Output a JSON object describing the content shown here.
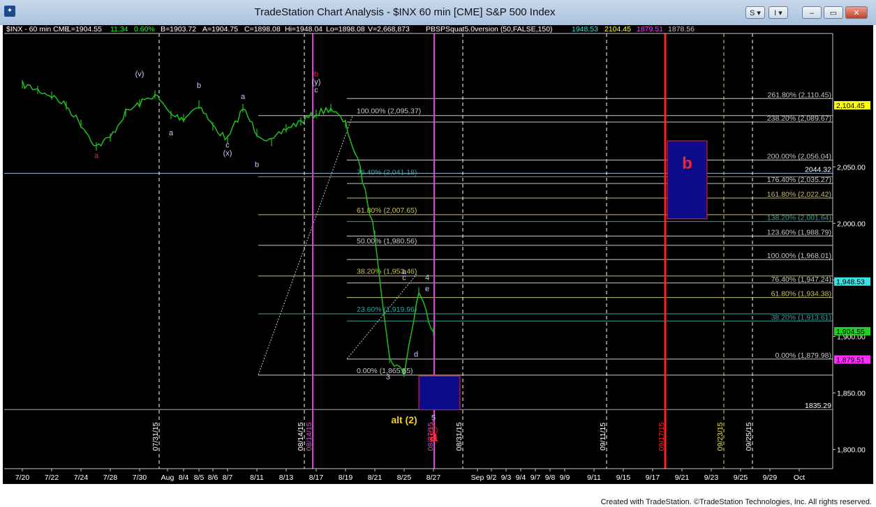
{
  "window": {
    "title": "TradeStation Chart Analysis - $INX 60 min [CME] S&P 500 Index",
    "btn_s": "S",
    "btn_i": "I",
    "footer": "Created with TradeStation. ©TradeStation Technologies, Inc. All rights reserved."
  },
  "header": {
    "symbol": "$INX - 60 min  CME",
    "last": "L=1904.55",
    "chg": "11.34",
    "pct": "0.60%",
    "bid": "B=1903.72",
    "ask": "A=1904.75",
    "close": "C=1898.08",
    "hi": "Hi=1948.04",
    "lo": "Lo=1898.08",
    "vol": "V=2,668,873",
    "indicator": "PBSPSquat5.0version (50,FALSE,150)",
    "ind_values": [
      "1948.53",
      "2104.45",
      "1879.51",
      "1878.56"
    ]
  },
  "chart_data": {
    "type": "line",
    "title": "$INX 60 min [CME] S&P 500 Index",
    "xlabel": "",
    "ylabel": "",
    "grid": false,
    "legend": "none",
    "x_ticks": [
      "7/20",
      "7/22",
      "7/24",
      "7/28",
      "7/30",
      "Aug",
      "8/4",
      "8/5",
      "8/6",
      "8/7",
      "8/11",
      "8/13",
      "8/17",
      "8/19",
      "8/21",
      "8/25",
      "8/27",
      "Sep",
      "9/2",
      "9/3",
      "9/4",
      "9/7",
      "9/8",
      "9/9",
      "9/11",
      "9/15",
      "9/17",
      "9/21",
      "9/23",
      "9/25",
      "9/29",
      "Oct"
    ],
    "y_ticks": [
      "2,050.00",
      "2,000.00",
      "1,950.00",
      "1,900.00",
      "1,850.00",
      "1,800.00"
    ],
    "ylim": [
      1783,
      2168
    ],
    "price_series": [
      {
        "t": "7/20",
        "p": 2123
      },
      {
        "t": "7/21",
        "p": 2118
      },
      {
        "t": "7/22",
        "p": 2113
      },
      {
        "t": "7/23",
        "p": 2104
      },
      {
        "t": "7/24",
        "p": 2088
      },
      {
        "t": "7/27",
        "p": 2068
      },
      {
        "t": "7/28",
        "p": 2076
      },
      {
        "t": "7/29",
        "p": 2098
      },
      {
        "t": "7/30",
        "p": 2106
      },
      {
        "t": "7/31",
        "p": 2114
      },
      {
        "t": "8/3",
        "p": 2096
      },
      {
        "t": "8/4",
        "p": 2093
      },
      {
        "t": "8/5",
        "p": 2105
      },
      {
        "t": "8/6",
        "p": 2086
      },
      {
        "t": "8/7",
        "p": 2074
      },
      {
        "t": "8/10",
        "p": 2102
      },
      {
        "t": "8/11",
        "p": 2080
      },
      {
        "t": "8/12",
        "p": 2072
      },
      {
        "t": "8/13",
        "p": 2084
      },
      {
        "t": "8/14",
        "p": 2090
      },
      {
        "t": "8/17",
        "p": 2097
      },
      {
        "t": "8/18",
        "p": 2102
      },
      {
        "t": "8/19",
        "p": 2088
      },
      {
        "t": "8/20",
        "p": 2048
      },
      {
        "t": "8/21",
        "p": 1990
      },
      {
        "t": "8/24",
        "p": 1880
      },
      {
        "t": "8/25",
        "p": 1868
      },
      {
        "t": "8/26",
        "p": 1940
      },
      {
        "t": "8/27",
        "p": 1904
      }
    ],
    "vertical_dates": [
      {
        "label": "07/31/15",
        "color": "#ffffff"
      },
      {
        "label": "08/14/15",
        "color": "#ffffff"
      },
      {
        "label": "08/14/15",
        "color": "#e040e0"
      },
      {
        "label": "08/27/15",
        "color": "#e040e0"
      },
      {
        "label": "08/31/15",
        "color": "#ffffff"
      },
      {
        "label": "09/11/15",
        "color": "#ffffff"
      },
      {
        "label": "09/17/15",
        "color": "#ff2020"
      },
      {
        "label": "09/23/15",
        "color": "#e8e040"
      },
      {
        "label": "09/25/15",
        "color": "#ffffff"
      }
    ],
    "fib_left": [
      {
        "label": "100.00% (2,095.37)",
        "value": 2095.37,
        "color": "#c8c8c8"
      },
      {
        "label": "76.40% (2,041.18)",
        "value": 2041.18,
        "color": "#3aa0a0"
      },
      {
        "label": "61.80% (2,007.65)",
        "value": 2007.65,
        "color": "#c8c060"
      },
      {
        "label": "50.00% (1,980.56)",
        "value": 1980.56,
        "color": "#c8c8c8"
      },
      {
        "label": "38.20% (1,953.46)",
        "value": 1953.46,
        "color": "#c8c060"
      },
      {
        "label": "23.60% (1,919.96)",
        "value": 1919.96,
        "color": "#3aa0a0"
      },
      {
        "label": "0.00% (1,865.75)",
        "value": 1865.75,
        "color": "#c8c8c8"
      }
    ],
    "fib_right": [
      {
        "label": "261.80% (2,110.45)",
        "value": 2110.45,
        "color": "#c8c8c8"
      },
      {
        "label": "238.20% (2,089.67)",
        "value": 2089.67,
        "color": "#c8c8c8"
      },
      {
        "label": "200.00% (2,056.04)",
        "value": 2056.04,
        "color": "#c8c8c8"
      },
      {
        "label": "176.40% (2,035.27)",
        "value": 2035.27,
        "color": "#c8c8c8"
      },
      {
        "label": "161.80% (2,022.42)",
        "value": 2022.42,
        "color": "#c8c060"
      },
      {
        "label": "138.20% (2,001.64)",
        "value": 2001.64,
        "color": "#3aa0a0"
      },
      {
        "label": "123.60% (1,988.79)",
        "value": 1988.79,
        "color": "#c8c8c8"
      },
      {
        "label": "100.00% (1,968.01)",
        "value": 1968.01,
        "color": "#c8c8c8"
      },
      {
        "label": "76.40% (1,947.24)",
        "value": 1947.24,
        "color": "#c8c8c8"
      },
      {
        "label": "61.80% (1,934.38)",
        "value": 1934.38,
        "color": "#c8c060"
      },
      {
        "label": "38.20% (1,913.61)",
        "value": 1913.61,
        "color": "#3aa0a0"
      },
      {
        "label": "0.00% (1,879.98)",
        "value": 1879.98,
        "color": "#c8c8c8"
      }
    ],
    "horizontal_levels": [
      {
        "label": "2044.32",
        "value": 2044.32
      },
      {
        "label": "1835.29",
        "value": 1835.29
      }
    ],
    "axis_badges": [
      {
        "label": "2,104.45",
        "value": 2104.45,
        "bg": "#ffff00",
        "fg": "#000000"
      },
      {
        "label": "1,948.53",
        "value": 1948.53,
        "bg": "#40e0e0",
        "fg": "#000000"
      },
      {
        "label": "1,904.55",
        "value": 1904.55,
        "bg": "#20d020",
        "fg": "#000000"
      },
      {
        "label": "1,879.51",
        "value": 1879.51,
        "bg": "#ff30ff",
        "fg": "#000000"
      }
    ],
    "target_boxes": [
      {
        "label": "b",
        "from": "9/18",
        "to": "9/22",
        "top": 2073,
        "bottom": 2004
      },
      {
        "label": "",
        "from": "8/26",
        "to": "8/31",
        "top": 1865,
        "bottom": 1835
      }
    ],
    "wave_labels": [
      {
        "text": "a",
        "t": "7/27",
        "p": 2058,
        "color": "#ff2020"
      },
      {
        "text": "(v)",
        "t": "7/30",
        "p": 2130,
        "color": "#c8c8ff"
      },
      {
        "text": "a",
        "t": "8/3",
        "p": 2078,
        "color": "#c8c8ff"
      },
      {
        "text": "b",
        "t": "8/5",
        "p": 2120,
        "color": "#c8c8ff"
      },
      {
        "text": "c",
        "t": "8/7",
        "p": 2067,
        "color": "#c8c8ff"
      },
      {
        "text": "(x)",
        "t": "8/7",
        "p": 2060,
        "color": "#c8c8ff"
      },
      {
        "text": "a",
        "t": "8/10",
        "p": 2110,
        "color": "#c8c8ff"
      },
      {
        "text": "b",
        "t": "8/11",
        "p": 2050,
        "color": "#c8c8ff"
      },
      {
        "text": "b",
        "t": "8/17",
        "p": 2130,
        "color": "#ff2020"
      },
      {
        "text": "(y)",
        "t": "8/17",
        "p": 2123,
        "color": "#c8c8ff"
      },
      {
        "text": "c",
        "t": "8/17",
        "p": 2116,
        "color": "#c8c8ff"
      },
      {
        "text": "a",
        "t": "8/25",
        "p": 1955,
        "color": "#c8c8ff"
      },
      {
        "text": "c",
        "t": "8/25",
        "p": 1950,
        "color": "#c8c8ff"
      },
      {
        "text": "4",
        "t": "8/26",
        "p": 1950,
        "color": "#c8c8ff"
      },
      {
        "text": "e",
        "t": "8/26",
        "p": 1940,
        "color": "#c8c8ff"
      },
      {
        "text": "d",
        "t": "8/26",
        "p": 1882,
        "color": "#c8c8ff"
      },
      {
        "text": "b",
        "t": "8/25",
        "p": 1867,
        "color": "#c8c8ff"
      },
      {
        "text": "3",
        "t": "8/24",
        "p": 1862,
        "color": "#c8c8ff"
      },
      {
        "text": "alt (2)",
        "t": "8/25",
        "p": 1823,
        "color": "#f0d020"
      },
      {
        "text": "5",
        "t": "8/27",
        "p": 1826,
        "color": "#c8c8ff"
      },
      {
        "text": "c",
        "t": "8/27",
        "p": 1822,
        "color": "#ff2020"
      },
      {
        "text": "(y)",
        "t": "8/27",
        "p": 1815,
        "color": "#ff2020"
      },
      {
        "text": "a",
        "t": "8/27",
        "p": 1807,
        "color": "#ff2020"
      }
    ]
  }
}
